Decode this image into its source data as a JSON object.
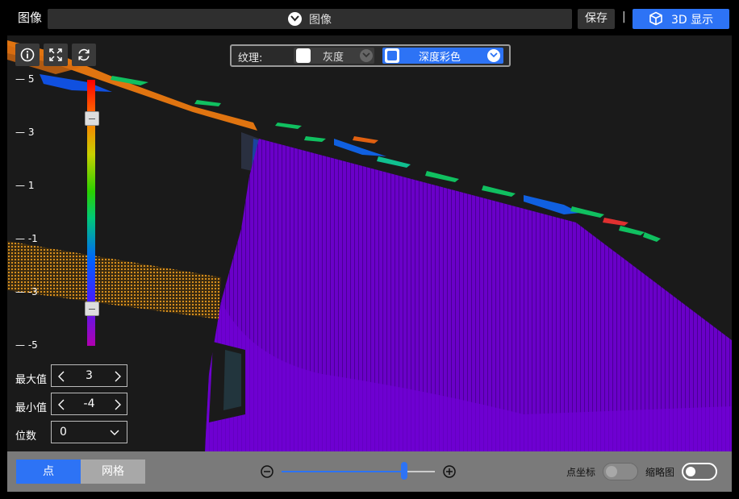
{
  "header": {
    "title": "图像",
    "source_select": "图像",
    "save_label": "保存",
    "separator": "|",
    "view3d_label": "3D 显示"
  },
  "toolbar": {
    "icons": [
      "info-icon",
      "fullscreen-icon",
      "refresh-icon"
    ]
  },
  "texture": {
    "label": "纹理:",
    "option_gray": "灰度",
    "option_depth": "深度彩色",
    "selected": "深度彩色"
  },
  "scale": {
    "ticks": [
      "5",
      "3",
      "1",
      "-1",
      "-3",
      "-5"
    ],
    "handle_max_value": 3,
    "handle_min_value": -4
  },
  "controls": {
    "max_label": "最大值",
    "max_value": "3",
    "min_label": "最小值",
    "min_value": "-4",
    "digits_label": "位数",
    "digits_value": "0"
  },
  "bottom": {
    "mode_point": "点",
    "mode_mesh": "网格",
    "zoom_level": 0.8,
    "point_coord_label": "点坐标",
    "thumbnail_label": "缩略图"
  },
  "colors": {
    "accent": "#2d73f5",
    "surface": "#7000d0",
    "background": "#1a1a1a"
  }
}
